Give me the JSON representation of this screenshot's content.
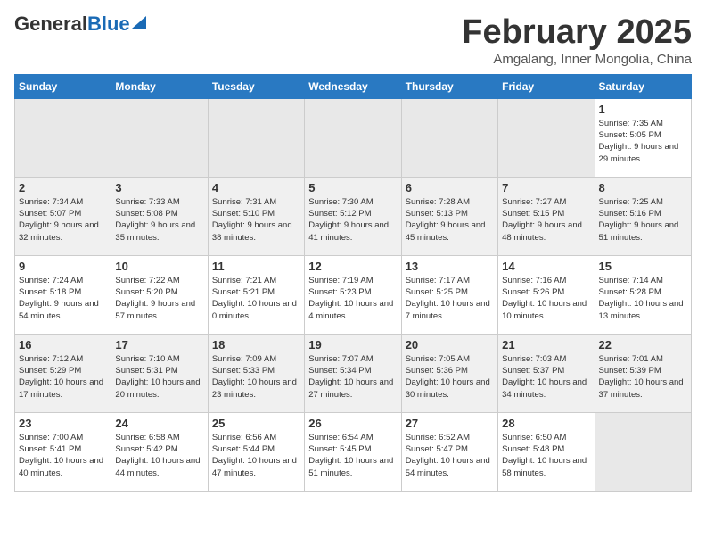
{
  "header": {
    "logo_general": "General",
    "logo_blue": "Blue",
    "month_title": "February 2025",
    "subtitle": "Amgalang, Inner Mongolia, China"
  },
  "weekdays": [
    "Sunday",
    "Monday",
    "Tuesday",
    "Wednesday",
    "Thursday",
    "Friday",
    "Saturday"
  ],
  "weeks": [
    [
      {
        "day": "",
        "info": ""
      },
      {
        "day": "",
        "info": ""
      },
      {
        "day": "",
        "info": ""
      },
      {
        "day": "",
        "info": ""
      },
      {
        "day": "",
        "info": ""
      },
      {
        "day": "",
        "info": ""
      },
      {
        "day": "1",
        "info": "Sunrise: 7:35 AM\nSunset: 5:05 PM\nDaylight: 9 hours and 29 minutes."
      }
    ],
    [
      {
        "day": "2",
        "info": "Sunrise: 7:34 AM\nSunset: 5:07 PM\nDaylight: 9 hours and 32 minutes."
      },
      {
        "day": "3",
        "info": "Sunrise: 7:33 AM\nSunset: 5:08 PM\nDaylight: 9 hours and 35 minutes."
      },
      {
        "day": "4",
        "info": "Sunrise: 7:31 AM\nSunset: 5:10 PM\nDaylight: 9 hours and 38 minutes."
      },
      {
        "day": "5",
        "info": "Sunrise: 7:30 AM\nSunset: 5:12 PM\nDaylight: 9 hours and 41 minutes."
      },
      {
        "day": "6",
        "info": "Sunrise: 7:28 AM\nSunset: 5:13 PM\nDaylight: 9 hours and 45 minutes."
      },
      {
        "day": "7",
        "info": "Sunrise: 7:27 AM\nSunset: 5:15 PM\nDaylight: 9 hours and 48 minutes."
      },
      {
        "day": "8",
        "info": "Sunrise: 7:25 AM\nSunset: 5:16 PM\nDaylight: 9 hours and 51 minutes."
      }
    ],
    [
      {
        "day": "9",
        "info": "Sunrise: 7:24 AM\nSunset: 5:18 PM\nDaylight: 9 hours and 54 minutes."
      },
      {
        "day": "10",
        "info": "Sunrise: 7:22 AM\nSunset: 5:20 PM\nDaylight: 9 hours and 57 minutes."
      },
      {
        "day": "11",
        "info": "Sunrise: 7:21 AM\nSunset: 5:21 PM\nDaylight: 10 hours and 0 minutes."
      },
      {
        "day": "12",
        "info": "Sunrise: 7:19 AM\nSunset: 5:23 PM\nDaylight: 10 hours and 4 minutes."
      },
      {
        "day": "13",
        "info": "Sunrise: 7:17 AM\nSunset: 5:25 PM\nDaylight: 10 hours and 7 minutes."
      },
      {
        "day": "14",
        "info": "Sunrise: 7:16 AM\nSunset: 5:26 PM\nDaylight: 10 hours and 10 minutes."
      },
      {
        "day": "15",
        "info": "Sunrise: 7:14 AM\nSunset: 5:28 PM\nDaylight: 10 hours and 13 minutes."
      }
    ],
    [
      {
        "day": "16",
        "info": "Sunrise: 7:12 AM\nSunset: 5:29 PM\nDaylight: 10 hours and 17 minutes."
      },
      {
        "day": "17",
        "info": "Sunrise: 7:10 AM\nSunset: 5:31 PM\nDaylight: 10 hours and 20 minutes."
      },
      {
        "day": "18",
        "info": "Sunrise: 7:09 AM\nSunset: 5:33 PM\nDaylight: 10 hours and 23 minutes."
      },
      {
        "day": "19",
        "info": "Sunrise: 7:07 AM\nSunset: 5:34 PM\nDaylight: 10 hours and 27 minutes."
      },
      {
        "day": "20",
        "info": "Sunrise: 7:05 AM\nSunset: 5:36 PM\nDaylight: 10 hours and 30 minutes."
      },
      {
        "day": "21",
        "info": "Sunrise: 7:03 AM\nSunset: 5:37 PM\nDaylight: 10 hours and 34 minutes."
      },
      {
        "day": "22",
        "info": "Sunrise: 7:01 AM\nSunset: 5:39 PM\nDaylight: 10 hours and 37 minutes."
      }
    ],
    [
      {
        "day": "23",
        "info": "Sunrise: 7:00 AM\nSunset: 5:41 PM\nDaylight: 10 hours and 40 minutes."
      },
      {
        "day": "24",
        "info": "Sunrise: 6:58 AM\nSunset: 5:42 PM\nDaylight: 10 hours and 44 minutes."
      },
      {
        "day": "25",
        "info": "Sunrise: 6:56 AM\nSunset: 5:44 PM\nDaylight: 10 hours and 47 minutes."
      },
      {
        "day": "26",
        "info": "Sunrise: 6:54 AM\nSunset: 5:45 PM\nDaylight: 10 hours and 51 minutes."
      },
      {
        "day": "27",
        "info": "Sunrise: 6:52 AM\nSunset: 5:47 PM\nDaylight: 10 hours and 54 minutes."
      },
      {
        "day": "28",
        "info": "Sunrise: 6:50 AM\nSunset: 5:48 PM\nDaylight: 10 hours and 58 minutes."
      },
      {
        "day": "",
        "info": ""
      }
    ]
  ]
}
